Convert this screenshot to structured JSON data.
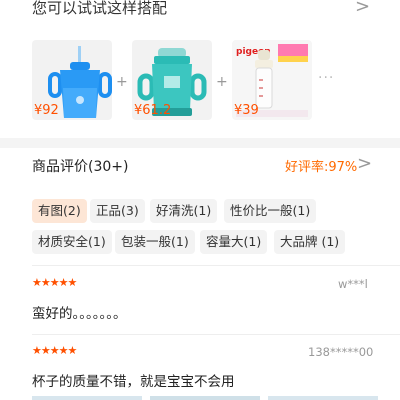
{
  "combo": {
    "title": "您可以试试这样搭配",
    "arrow": ">",
    "products": [
      {
        "price": "¥92",
        "color": "#1e8ff0"
      },
      {
        "price": "¥61.2",
        "color": "#2bbbb5"
      },
      {
        "price": "¥39",
        "brand": "pigeon",
        "color": "#e02020"
      }
    ],
    "plus": "+",
    "more": "···"
  },
  "reviews": {
    "title": "商品评价(30+)",
    "good_rate": "好评率:97%",
    "arrow": ">",
    "tags": [
      "有图(2)",
      "正品(3)",
      "好清洗(1)",
      "性价比一般(1)",
      "材质安全(1)",
      "包装一般(1)",
      "容量大(1)",
      "大品牌 (1)"
    ],
    "items": [
      {
        "stars": "★★★★★",
        "user": "w***l",
        "text": "蛮好的。。。。。。。"
      },
      {
        "stars": "★★★★★",
        "user": "138*****00",
        "text": "杯子的质量不错，就是宝宝不会用"
      }
    ]
  },
  "colors": {
    "accent": "#ff5000",
    "rate": "#ff6a00",
    "tag_active": "#fde6d6"
  }
}
